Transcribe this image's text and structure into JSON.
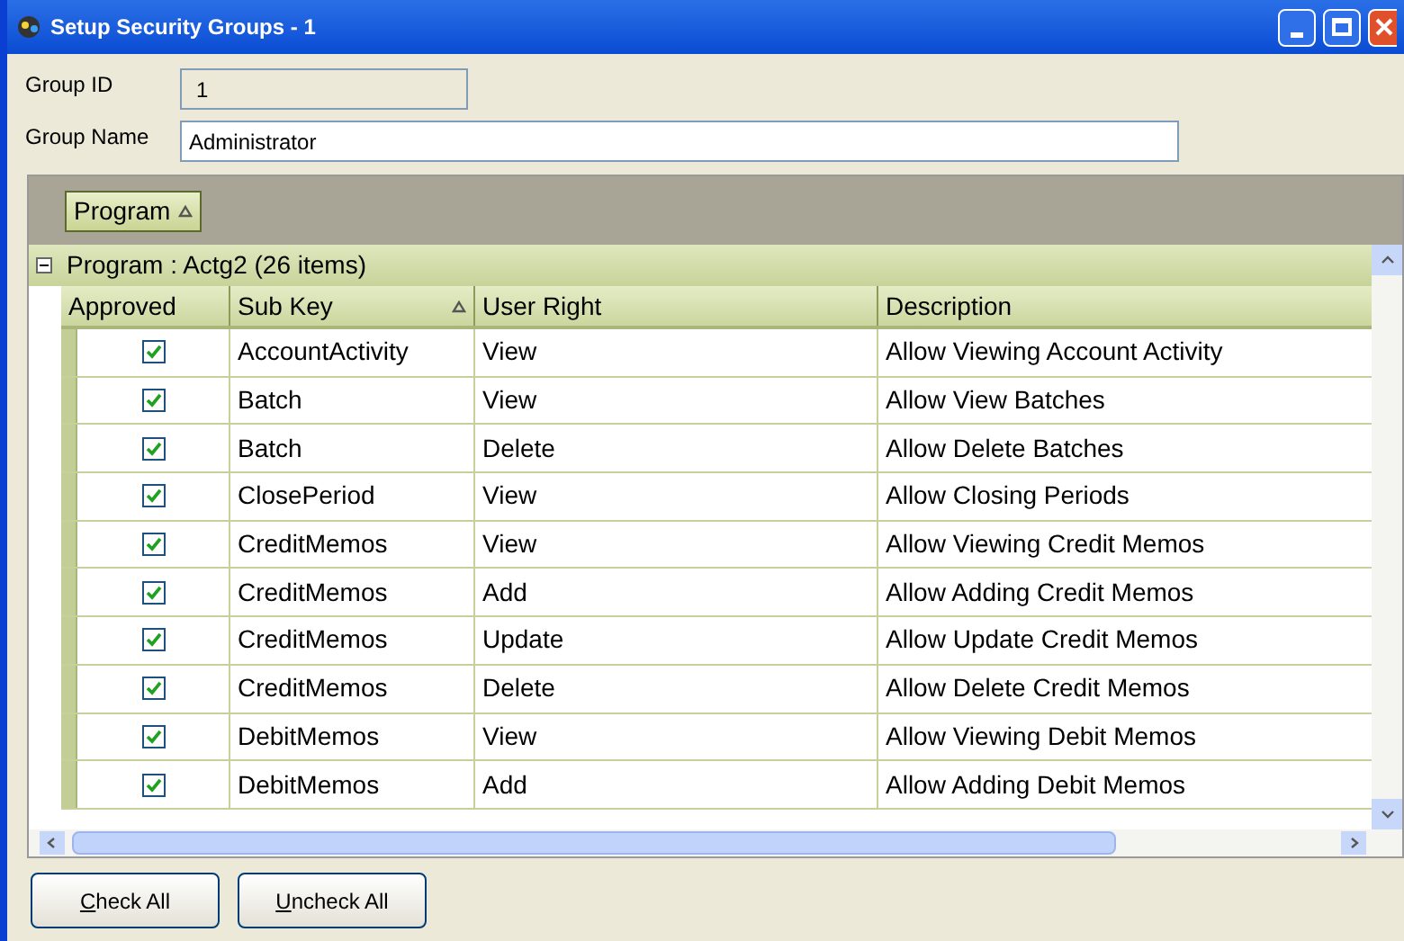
{
  "window": {
    "title": "Setup Security Groups - 1"
  },
  "form": {
    "group_id_label": "Group ID",
    "group_id": "1",
    "group_name_label": "Group Name",
    "group_name": "Administrator"
  },
  "group_by": {
    "label": "Program"
  },
  "group": {
    "label": "Program : Actg2 (26 items)",
    "expanded": true
  },
  "table": {
    "columns": [
      {
        "label": "Approved",
        "sorted": false
      },
      {
        "label": "Sub Key",
        "sorted": true
      },
      {
        "label": "User Right",
        "sorted": false
      },
      {
        "label": "Description",
        "sorted": false
      }
    ],
    "rows": [
      {
        "approved": true,
        "sub_key": "AccountActivity",
        "user_right": "View",
        "description": "Allow Viewing Account Activity"
      },
      {
        "approved": true,
        "sub_key": "Batch",
        "user_right": "View",
        "description": "Allow View Batches"
      },
      {
        "approved": true,
        "sub_key": "Batch",
        "user_right": "Delete",
        "description": "Allow Delete Batches"
      },
      {
        "approved": true,
        "sub_key": "ClosePeriod",
        "user_right": "View",
        "description": "Allow Closing Periods"
      },
      {
        "approved": true,
        "sub_key": "CreditMemos",
        "user_right": "View",
        "description": "Allow Viewing Credit Memos"
      },
      {
        "approved": true,
        "sub_key": "CreditMemos",
        "user_right": "Add",
        "description": "Allow Adding Credit Memos"
      },
      {
        "approved": true,
        "sub_key": "CreditMemos",
        "user_right": "Update",
        "description": "Allow Update Credit Memos"
      },
      {
        "approved": true,
        "sub_key": "CreditMemos",
        "user_right": "Delete",
        "description": "Allow Delete Credit Memos"
      },
      {
        "approved": true,
        "sub_key": "DebitMemos",
        "user_right": "View",
        "description": "Allow Viewing Debit Memos"
      },
      {
        "approved": true,
        "sub_key": "DebitMemos",
        "user_right": "Add",
        "description": "Allow Adding Debit Memos"
      }
    ]
  },
  "buttons": [
    "Check All",
    "Uncheck All"
  ]
}
